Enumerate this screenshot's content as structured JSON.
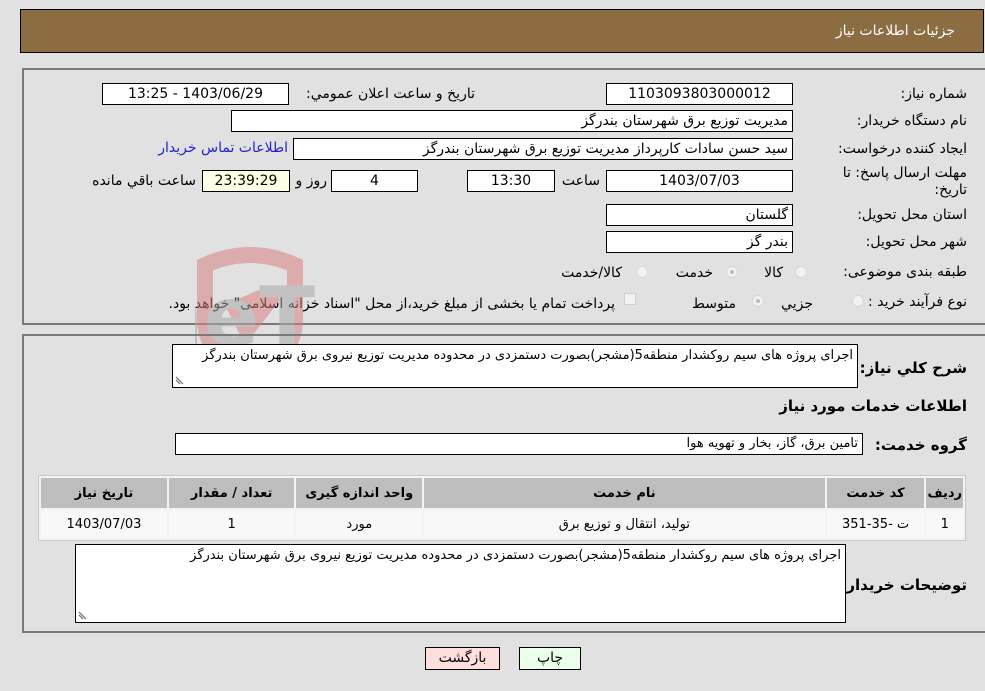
{
  "header": {
    "title": "جزئیات اطلاعات نیاز"
  },
  "details": {
    "need_number_label": "شماره نیاز:",
    "need_number": "1103093803000012",
    "announce_label": "تاریخ و ساعت اعلان عمومي:",
    "announce_value": "1403/06/29 - 13:25",
    "buyer_org_label": "نام دستگاه خریدار:",
    "buyer_org": "مدیریت توزیع برق شهرستان بندرگز",
    "creator_label": "ایجاد کننده درخواست:",
    "creator": "سید حسن سادات کارپرداز مدیریت توزیع برق شهرستان بندرگز",
    "contact_link": "اطلاعات تماس خریدار",
    "deadline_label": "مهلت ارسال پاسخ: تا تاریخ:",
    "deadline_date": "1403/07/03",
    "time_label": "ساعت",
    "deadline_time": "13:30",
    "days_value": "4",
    "days_label": "روز و",
    "remaining_time": "23:39:29",
    "remaining_label": "ساعت باقي مانده",
    "province_label": "استان محل تحویل:",
    "province": "گلستان",
    "city_label": "شهر محل تحویل:",
    "city": "بندر گز",
    "category_label": "طبقه بندی موضوعی:",
    "category_options": [
      "کالا",
      "خدمت",
      "کالا/خدمت"
    ],
    "category_selected": "خدمت",
    "process_label": "نوع فرآیند خرید :",
    "process_options": [
      "جزيي",
      "متوسط"
    ],
    "process_selected": "متوسط",
    "treasury_note": "پرداخت تمام یا بخشی از مبلغ خرید،از محل \"اسناد خزانه اسلامی\" خواهد بود."
  },
  "description": {
    "label": "شرح کلي نیاز:",
    "text": "اجرای پروژه های سیم روکشدار منطقه5(مشجر)بصورت دستمزدی در محدوده مدیریت توزیع نیروی برق شهرستان بندرگز"
  },
  "services": {
    "section_title": "اطلاعات خدمات مورد نیاز",
    "group_label": "گروه خدمت:",
    "group_value": "تامین برق، گاز، بخار و تهویه هوا",
    "columns": [
      "ردیف",
      "کد خدمت",
      "نام خدمت",
      "واحد اندازه گیری",
      "تعداد / مقدار",
      "تاریخ نیاز"
    ],
    "rows": [
      [
        "1",
        "ت -35-351",
        "تولید، انتقال و توزیع برق",
        "مورد",
        "1",
        "1403/07/03"
      ]
    ]
  },
  "buyer_notes": {
    "label": "توضیحات خریدار:",
    "text": "اجرای پروژه های سیم روکشدار منطقه5(مشجر)بصورت دستمزدی در محدوده مدیریت توزیع نیروی برق شهرستان بندرگز"
  },
  "buttons": {
    "print": "چاپ",
    "back": "بازگشت"
  },
  "colors": {
    "header_bg": "#8c6d42",
    "print_bg": "#eaffea",
    "back_bg": "#ffdede",
    "link": "#2222cc"
  },
  "watermark": {
    "text": "AriaTender.neT"
  }
}
